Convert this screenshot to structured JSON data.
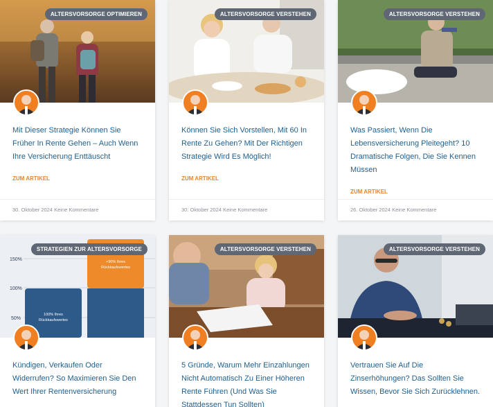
{
  "posts": [
    {
      "category": "Altersvorsorge optimieren",
      "title": "Mit Dieser Strategie Können Sie Früher In Rente Gehen – Auch Wenn Ihre Versicherung Enttäuscht",
      "cta": "Zum Artikel",
      "date": "30. Oktober 2024",
      "comments": "Keine Kommentare"
    },
    {
      "category": "Altersvorsorge verstehen",
      "title": "Können Sie Sich Vorstellen, Mit 60 In Rente Zu Gehen? Mit Der Richtigen Strategie Wird Es Möglich!",
      "cta": "Zum Artikel",
      "date": "30. Oktober 2024",
      "comments": "Keine Kommentare"
    },
    {
      "category": "Altersvorsorge verstehen",
      "title": "Was Passiert, Wenn Die Lebensversicherung Pleitegeht? 10 Dramatische Folgen, Die Sie Kennen Müssen",
      "cta": "Zum Artikel",
      "date": "26. Oktober 2024",
      "comments": "Keine Kommentare"
    },
    {
      "category": "Strategien zur Altersvorsorge",
      "title": "Kündigen, Verkaufen Oder Widerrufen? So Maximieren Sie Den Wert Ihrer Rentenversicherung"
    },
    {
      "category": "Altersvorsorge verstehen",
      "title": "5 Gründe, Warum Mehr Einzahlungen Nicht Automatisch Zu Einer Höheren Rente Führen (Und Was Sie Stattdessen Tun Sollten)"
    },
    {
      "category": "Altersvorsorge verstehen",
      "title": "Vertrauen Sie Auf Die Zinserhöhungen? Das Sollten Sie Wissen, Bevor Sie Sich Zurücklehnen."
    }
  ],
  "thumb_chart": {
    "ticks": [
      "150%",
      "100%",
      "50%"
    ],
    "bar1_label_1": "100% Ihres",
    "bar1_label_2": "Rückkaufswertes",
    "bar2_label_1": "+90% Ihres",
    "bar2_label_2": "Rückkaufswertes"
  },
  "colors": {
    "accent": "#e8842c",
    "title": "#1f5f8f",
    "badge": "#5f6775"
  }
}
